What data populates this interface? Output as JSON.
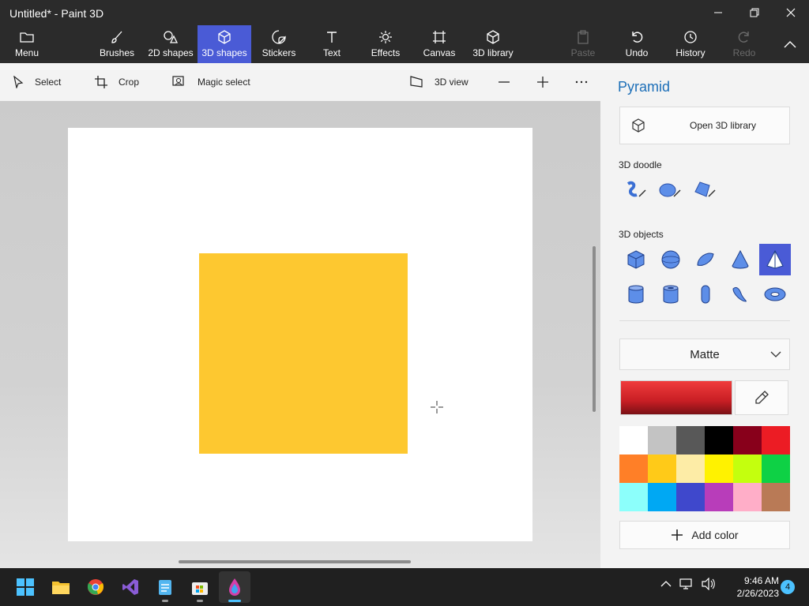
{
  "window": {
    "title": "Untitled* - Paint 3D"
  },
  "ribbon": {
    "menu": "Menu",
    "tabs": [
      "Brushes",
      "2D shapes",
      "3D shapes",
      "Stickers",
      "Text",
      "Effects",
      "Canvas",
      "3D library"
    ],
    "active_tab": "3D shapes",
    "paste": "Paste",
    "undo": "Undo",
    "history": "History",
    "redo": "Redo"
  },
  "commandbar": {
    "select": "Select",
    "crop": "Crop",
    "magic_select": "Magic select",
    "view3d": "3D view"
  },
  "canvas": {
    "shape_color": "#fdc830"
  },
  "panel": {
    "title": "Pyramid",
    "open_library": "Open 3D library",
    "doodle_heading": "3D doodle",
    "objects_heading": "3D objects",
    "selected_object": "pyramid",
    "material": "Matte",
    "current_color": "#e62a2f",
    "palette": [
      "#ffffff",
      "#c3c3c3",
      "#585858",
      "#000000",
      "#88001b",
      "#ec1c24",
      "#ff7f27",
      "#ffca18",
      "#fdeca6",
      "#fff200",
      "#c4ff0e",
      "#0ed145",
      "#8cfffb",
      "#00a8f3",
      "#3f48cc",
      "#b83dba",
      "#ffaec8",
      "#b97a56"
    ],
    "add_color": "Add color"
  },
  "taskbar": {
    "time": "9:46 AM",
    "date": "2/26/2023",
    "notifications": "4"
  }
}
